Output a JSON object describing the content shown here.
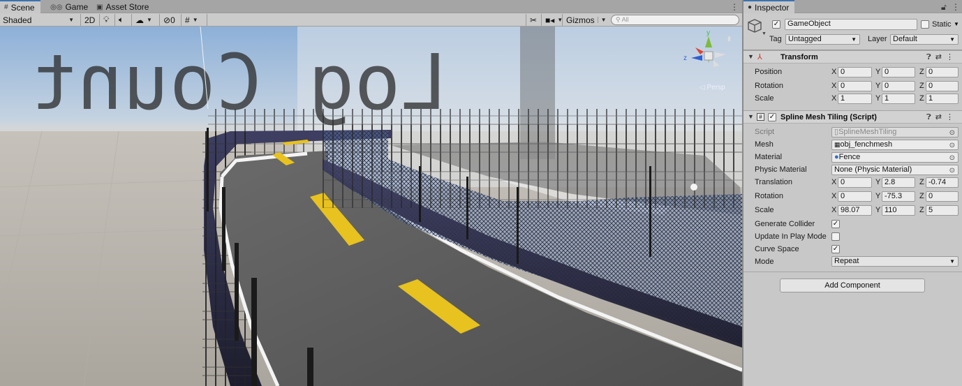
{
  "scene_tabs": [
    {
      "label": "Scene",
      "icon": "grid-icon"
    },
    {
      "label": "Game",
      "icon": "gamepad-icon"
    },
    {
      "label": "Asset Store",
      "icon": "bag-icon"
    }
  ],
  "scene_toolbar": {
    "shading_mode": "Shaded",
    "mode_2d": "2D",
    "hidden_count": "0",
    "gizmos": "Gizmos",
    "search_placeholder": "All"
  },
  "gizmo": {
    "y": "y",
    "z": "z",
    "persp": "Persp"
  },
  "inspector_tab": {
    "label": "Inspector",
    "icon": "info-icon"
  },
  "gameobject": {
    "enabled": true,
    "name": "GameObject",
    "static_label": "Static",
    "tag_label": "Tag",
    "tag_value": "Untagged",
    "layer_label": "Layer",
    "layer_value": "Default"
  },
  "transform": {
    "title": "Transform",
    "rows": [
      {
        "label": "Position",
        "x": "0",
        "y": "0",
        "z": "0"
      },
      {
        "label": "Rotation",
        "x": "0",
        "y": "0",
        "z": "0"
      },
      {
        "label": "Scale",
        "x": "1",
        "y": "1",
        "z": "1"
      }
    ]
  },
  "axis_labels": {
    "x": "X",
    "y": "Y",
    "z": "Z"
  },
  "spline": {
    "title": "Spline Mesh Tiling (Script)",
    "enabled": true,
    "script_label": "Script",
    "script_value": "SplineMeshTiling",
    "mesh_label": "Mesh",
    "mesh_value": "obj_fenchmesh",
    "material_label": "Material",
    "material_value": "Fence",
    "physic_label": "Physic Material",
    "physic_value": "None (Physic Material)",
    "translation": {
      "label": "Translation",
      "x": "0",
      "y": "2.8",
      "z": "-0.74"
    },
    "rotation": {
      "label": "Rotation",
      "x": "0",
      "y": "-75.3",
      "z": "0"
    },
    "scale": {
      "label": "Scale",
      "x": "98.07",
      "y": "110",
      "z": "5"
    },
    "generate_collider": {
      "label": "Generate Collider",
      "checked": true
    },
    "update_in_play": {
      "label": "Update In Play Mode",
      "checked": false
    },
    "curve_space": {
      "label": "Curve Space",
      "checked": true
    },
    "mode_label": "Mode",
    "mode_value": "Repeat"
  },
  "add_component": "Add Component",
  "colors": {
    "accent": "#3a72b0",
    "road_line": "#e8c21e",
    "sky": "#8db0d8"
  }
}
